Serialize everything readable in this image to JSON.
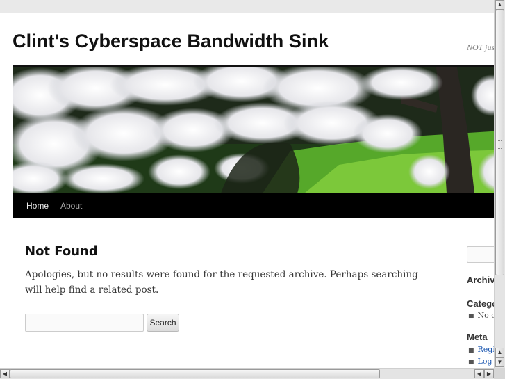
{
  "site": {
    "title": "Clint's Cyberspace Bandwidth Sink",
    "description": "NOT just"
  },
  "banner": {
    "image": "cherry-blossom-tree-header"
  },
  "nav": {
    "items": [
      {
        "label": "Home"
      },
      {
        "label": "About"
      }
    ]
  },
  "main": {
    "title": "Not Found",
    "text": "Apologies, but no results were found for the requested archive. Perhaps searching will help find a related post.",
    "search_placeholder": "",
    "search_button": "Search"
  },
  "sidebar": {
    "archives_heading": "Archiv",
    "categories_heading": "Catego",
    "categories_item": "No ca",
    "meta_heading": "Meta",
    "meta_items": [
      "Regis",
      "Log in"
    ]
  },
  "scrollbars": {
    "up_icon": "▲",
    "down_icon": "▼",
    "left_icon": "◀",
    "right_icon": "▶"
  },
  "colors": {
    "nav_background": "#000000",
    "link": "#1b57b1",
    "page_background": "#e9e9e9"
  }
}
